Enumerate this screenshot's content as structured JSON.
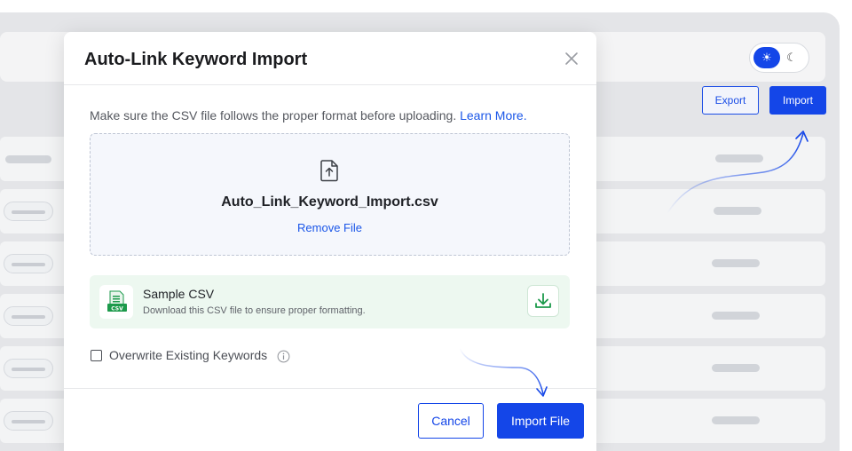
{
  "background": {
    "theme_toggle": {
      "sun_icon": "sun-icon",
      "moon_icon": "moon-icon"
    },
    "export_label": "Export",
    "import_label": "Import"
  },
  "modal": {
    "title": "Auto-Link Keyword Import",
    "close_icon": "close-icon",
    "intro_text": "Make sure the CSV file follows the proper format before uploading.",
    "learn_more": "Learn More.",
    "dropzone": {
      "file_icon": "file-upload-icon",
      "file_name": "Auto_Link_Keyword_Import.csv",
      "remove_label": "Remove File"
    },
    "sample": {
      "icon": "csv-file-icon",
      "icon_text": "CSV",
      "title": "Sample CSV",
      "description": "Download this CSV file to ensure proper formatting.",
      "download_icon": "download-icon"
    },
    "overwrite": {
      "label": "Overwrite Existing Keywords",
      "checked": false,
      "info_icon": "info-icon"
    },
    "footer": {
      "cancel_label": "Cancel",
      "import_label": "Import File"
    }
  },
  "colors": {
    "primary": "#1446e8",
    "link": "#1a56e8",
    "sample_bg": "#edf8f0",
    "csv_green": "#1c9a4b"
  }
}
